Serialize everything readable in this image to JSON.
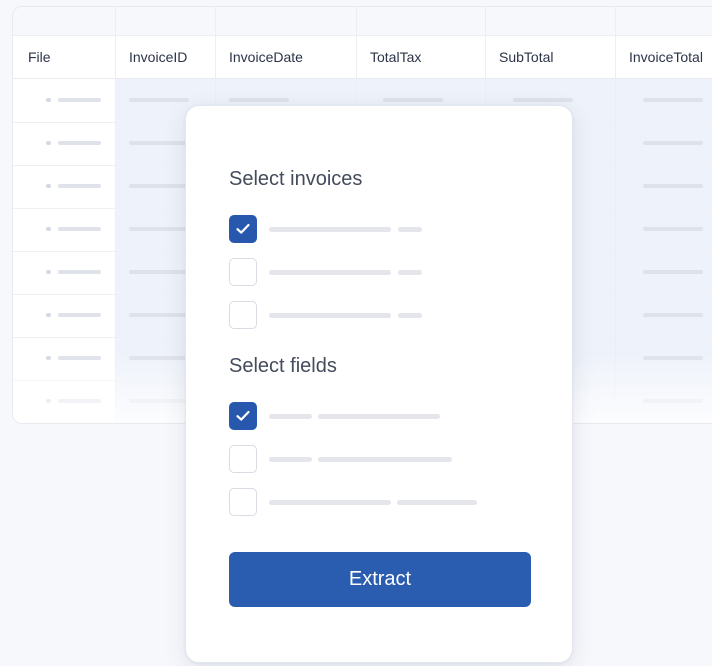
{
  "table": {
    "columns": [
      "File",
      "InvoiceID",
      "InvoiceDate",
      "TotalTax",
      "SubTotal",
      "InvoiceTotal"
    ]
  },
  "modal": {
    "invoices_title": "Select invoices",
    "fields_title": "Select fields",
    "invoice_options": [
      {
        "checked": true
      },
      {
        "checked": false
      },
      {
        "checked": false
      }
    ],
    "field_options": [
      {
        "checked": true
      },
      {
        "checked": false
      },
      {
        "checked": false
      }
    ],
    "extract_label": "Extract"
  },
  "colors": {
    "accent": "#2a5cb0",
    "checked_box": "#2858ad"
  },
  "icons": {
    "checkmark": "check-icon"
  }
}
